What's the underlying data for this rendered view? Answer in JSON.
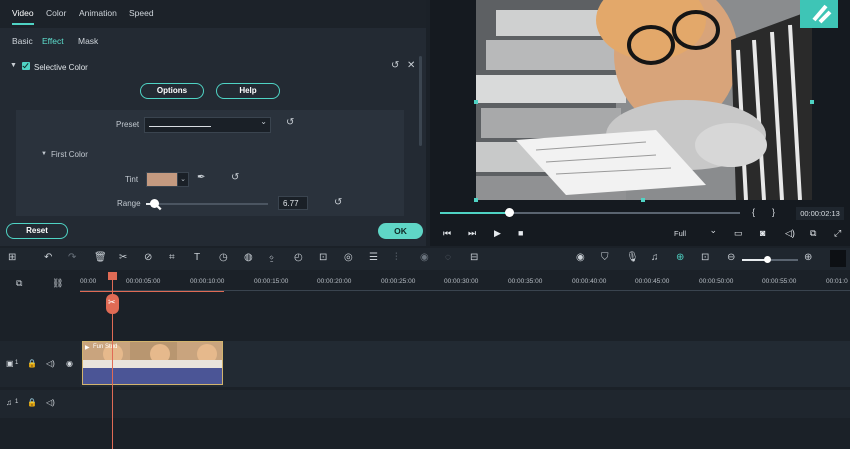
{
  "tabs_primary": [
    "Video",
    "Color",
    "Animation",
    "Speed"
  ],
  "tabs_secondary": [
    "Basic",
    "Effect",
    "Mask"
  ],
  "section": {
    "title": "Selective Color",
    "enabled": true
  },
  "buttons": {
    "options": "Options",
    "help": "Help",
    "reset": "Reset",
    "ok": "OK"
  },
  "preset": {
    "label": "Preset",
    "value": ""
  },
  "first_color": {
    "title": "First Color",
    "tint_label": "Tint",
    "tint_color": "#c49a80",
    "range_label": "Range",
    "range_value": "6.77",
    "range_fraction": 0.05
  },
  "player": {
    "timecode": "00:00:02:13",
    "quality": "Full",
    "progress_fraction": 0.23,
    "bracket_open": "{",
    "bracket_close": "}"
  },
  "timeline": {
    "ruler": [
      "00:00",
      "00:00:05:00",
      "00:00:10:00",
      "00:00:15:00",
      "00:00:20:00",
      "00:00:25:00",
      "00:00:30:00",
      "00:00:35:00",
      "00:00:40:00",
      "00:00:45:00",
      "00:00:50:00",
      "00:00:55:00",
      "00:01:0"
    ],
    "clip_name": "Fun Stud",
    "video_track": "1",
    "audio_track": "1"
  },
  "colors": {
    "accent": "#4fd3c4",
    "playhead": "#e06b55",
    "clip_fill": "#4b5596",
    "clip_border": "#d2b46e"
  }
}
